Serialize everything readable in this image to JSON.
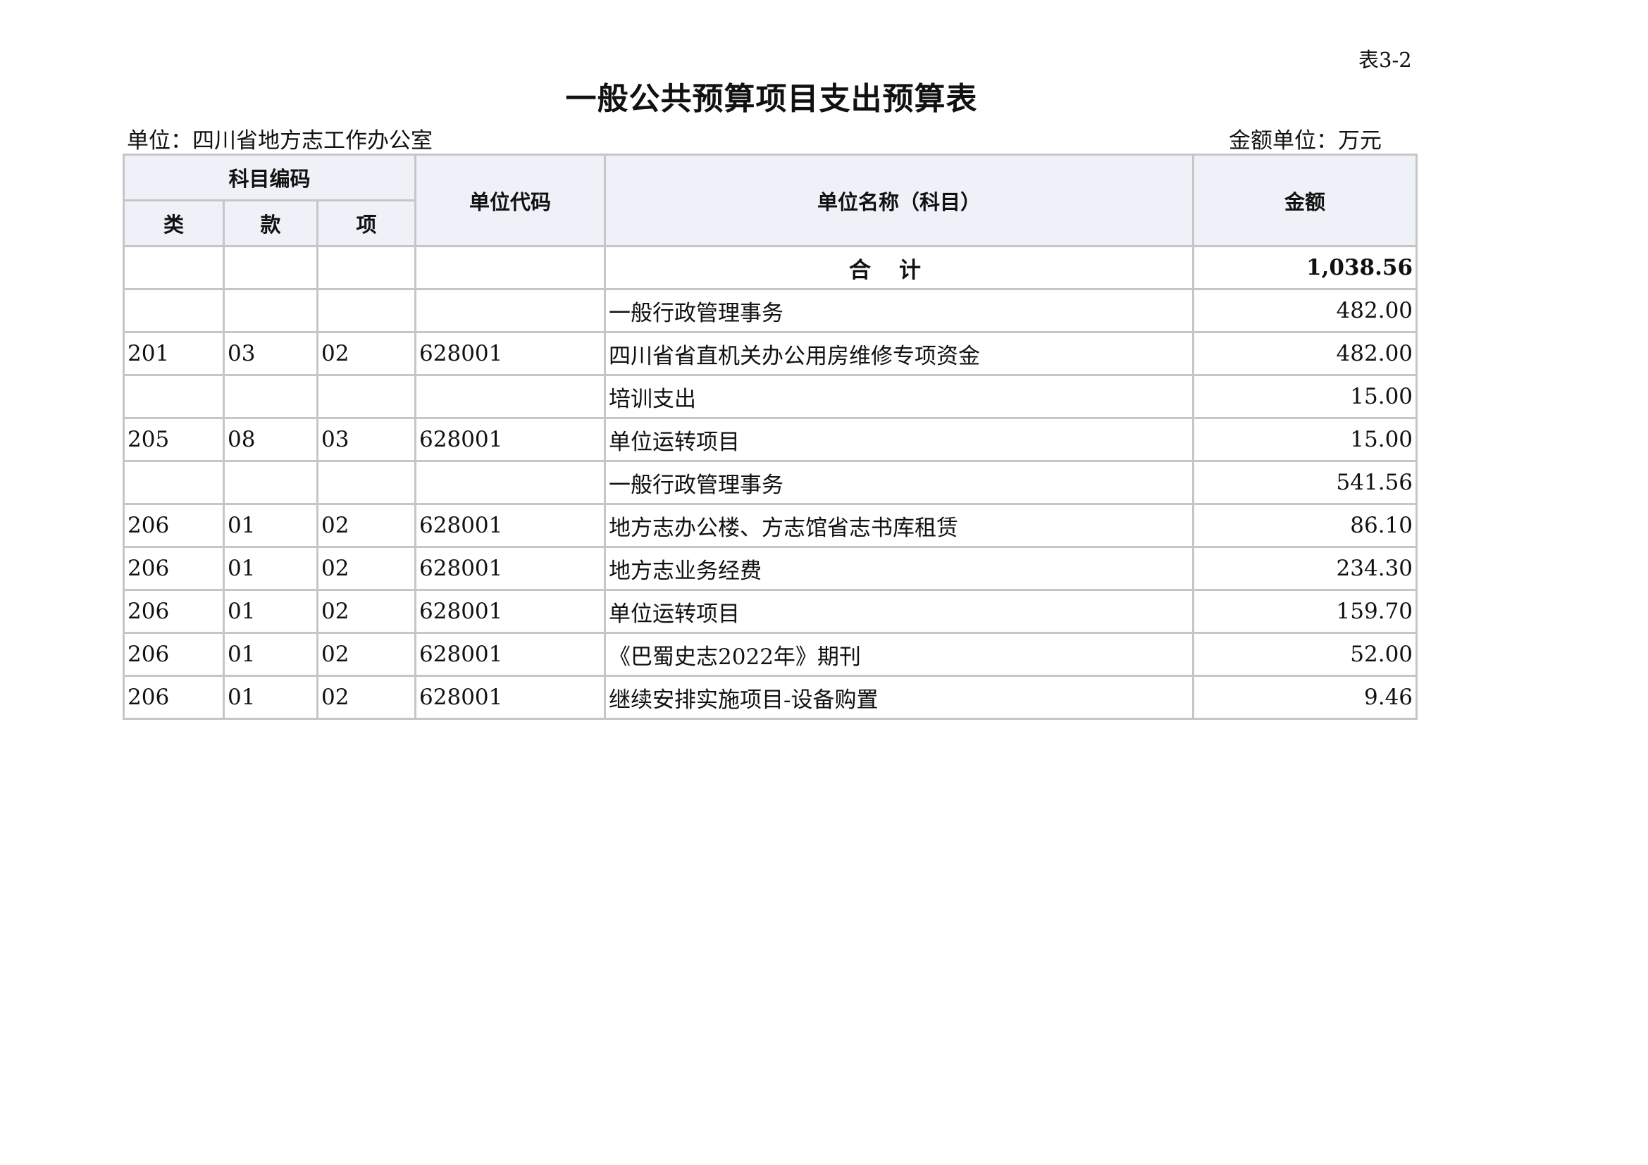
{
  "page": {
    "table_no": "表3-2",
    "title": "一般公共预算项目支出预算表",
    "unit_label": "单位：四川省地方志工作办公室",
    "amount_unit_label": "金额单位：万元"
  },
  "table": {
    "headers": {
      "subject_code": "科目编码",
      "lei": "类",
      "kuan": "款",
      "xiang": "项",
      "unit_code": "单位代码",
      "unit_name": "单位名称（科目）",
      "amount": "金额"
    },
    "total": {
      "label": "合计",
      "amount": "1,038.56"
    },
    "rows": [
      {
        "lei": "",
        "kuan": "",
        "xiang": "",
        "code": "",
        "name": "一般行政管理事务",
        "amount": "482.00",
        "level": "group"
      },
      {
        "lei": "201",
        "kuan": "03",
        "xiang": "02",
        "code": "628001",
        "name": "四川省省直机关办公用房维修专项资金",
        "amount": "482.00",
        "level": "item"
      },
      {
        "lei": "",
        "kuan": "",
        "xiang": "",
        "code": "",
        "name": "培训支出",
        "amount": "15.00",
        "level": "group"
      },
      {
        "lei": "205",
        "kuan": "08",
        "xiang": "03",
        "code": "628001",
        "name": "单位运转项目",
        "amount": "15.00",
        "level": "item"
      },
      {
        "lei": "",
        "kuan": "",
        "xiang": "",
        "code": "",
        "name": "一般行政管理事务",
        "amount": "541.56",
        "level": "group"
      },
      {
        "lei": "206",
        "kuan": "01",
        "xiang": "02",
        "code": "628001",
        "name": "地方志办公楼、方志馆省志书库租赁",
        "amount": "86.10",
        "level": "item"
      },
      {
        "lei": "206",
        "kuan": "01",
        "xiang": "02",
        "code": "628001",
        "name": "地方志业务经费",
        "amount": "234.30",
        "level": "item"
      },
      {
        "lei": "206",
        "kuan": "01",
        "xiang": "02",
        "code": "628001",
        "name": "单位运转项目",
        "amount": "159.70",
        "level": "item"
      },
      {
        "lei": "206",
        "kuan": "01",
        "xiang": "02",
        "code": "628001",
        "name": "《巴蜀史志2022年》期刊",
        "amount": "52.00",
        "level": "item"
      },
      {
        "lei": "206",
        "kuan": "01",
        "xiang": "02",
        "code": "628001",
        "name": "继续安排实施项目-设备购置",
        "amount": "9.46",
        "level": "item"
      }
    ]
  }
}
